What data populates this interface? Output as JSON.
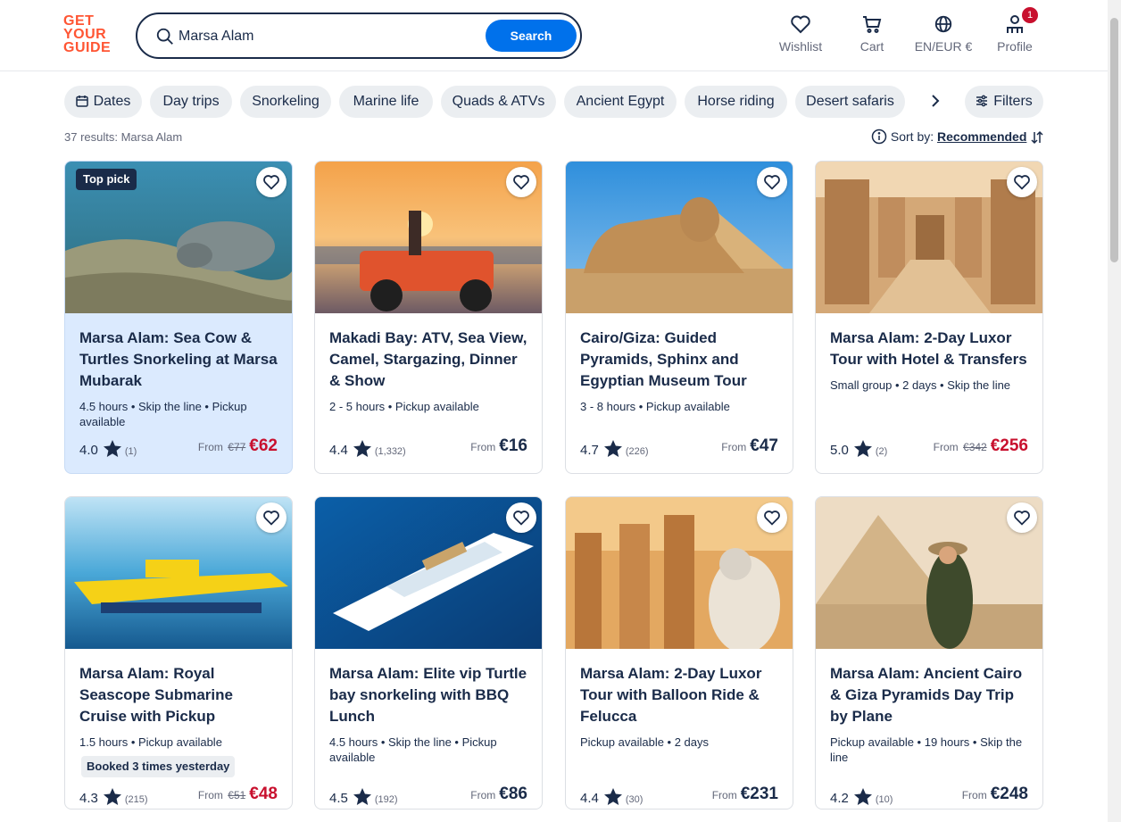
{
  "header": {
    "logo_lines": [
      "GET",
      "YOUR",
      "GUIDE"
    ],
    "search_value": "Marsa Alam",
    "search_button": "Search",
    "nav": {
      "wishlist": "Wishlist",
      "cart": "Cart",
      "language": "EN/EUR €",
      "profile": "Profile",
      "profile_badge": "1"
    }
  },
  "chips": [
    "Dates",
    "Day trips",
    "Snorkeling",
    "Marine life",
    "Quads & ATVs",
    "Ancient Egypt",
    "Horse riding",
    "Desert safaris"
  ],
  "filters_label": "Filters",
  "results_count": "37 results: Marsa Alam",
  "sort": {
    "label": "Sort by:",
    "value": "Recommended"
  },
  "colors": {
    "accent": "#0071eb",
    "brand": "#ff5533",
    "sale": "#c8102e",
    "text": "#1a2b49"
  },
  "cards": [
    {
      "badge": "Top pick",
      "title": "Marsa Alam: Sea Cow & Turtles Snorkeling at Marsa Mubarak",
      "meta": "4.5 hours • Skip the line • Pickup available",
      "rating": "4.0",
      "reviews": "(1)",
      "from": "From",
      "old_price": "€77",
      "price": "€62",
      "sale": true
    },
    {
      "title": "Makadi Bay: ATV, Sea View, Camel, Stargazing, Dinner & Show",
      "meta": "2 - 5 hours • Pickup available",
      "rating": "4.4",
      "reviews": "(1,332)",
      "from": "From",
      "price": "€16",
      "sale": false
    },
    {
      "title": "Cairo/Giza: Guided Pyramids, Sphinx and Egyptian Museum Tour",
      "meta": "3 - 8 hours • Pickup available",
      "rating": "4.7",
      "reviews": "(226)",
      "from": "From",
      "price": "€47",
      "sale": false
    },
    {
      "title": "Marsa Alam: 2-Day Luxor Tour with Hotel & Transfers",
      "meta": "Small group • 2 days • Skip the line",
      "rating": "5.0",
      "reviews": "(2)",
      "from": "From",
      "old_price": "€342",
      "price": "€256",
      "sale": true
    },
    {
      "title": "Marsa Alam: Royal Seascope Submarine Cruise with Pickup",
      "meta": "1.5 hours • Pickup available",
      "booked": "Booked 3 times yesterday",
      "rating": "4.3",
      "reviews": "(215)",
      "from": "From",
      "old_price": "€51",
      "price": "€48",
      "sale": true
    },
    {
      "title": "Marsa Alam: Elite vip Turtle bay snorkeling with BBQ Lunch",
      "meta": "4.5 hours • Skip the line • Pickup available",
      "rating": "4.5",
      "reviews": "(192)",
      "from": "From",
      "price": "€86",
      "sale": false
    },
    {
      "title": "Marsa Alam: 2-Day Luxor Tour with Balloon Ride & Felucca",
      "meta": "Pickup available • 2 days",
      "rating": "4.4",
      "reviews": "(30)",
      "from": "From",
      "price": "€231",
      "sale": false
    },
    {
      "title": "Marsa Alam: Ancient Cairo & Giza Pyramids Day Trip by Plane",
      "meta": "Pickup available • 19 hours • Skip the line",
      "rating": "4.2",
      "reviews": "(10)",
      "from": "From",
      "price": "€248",
      "sale": false
    }
  ]
}
